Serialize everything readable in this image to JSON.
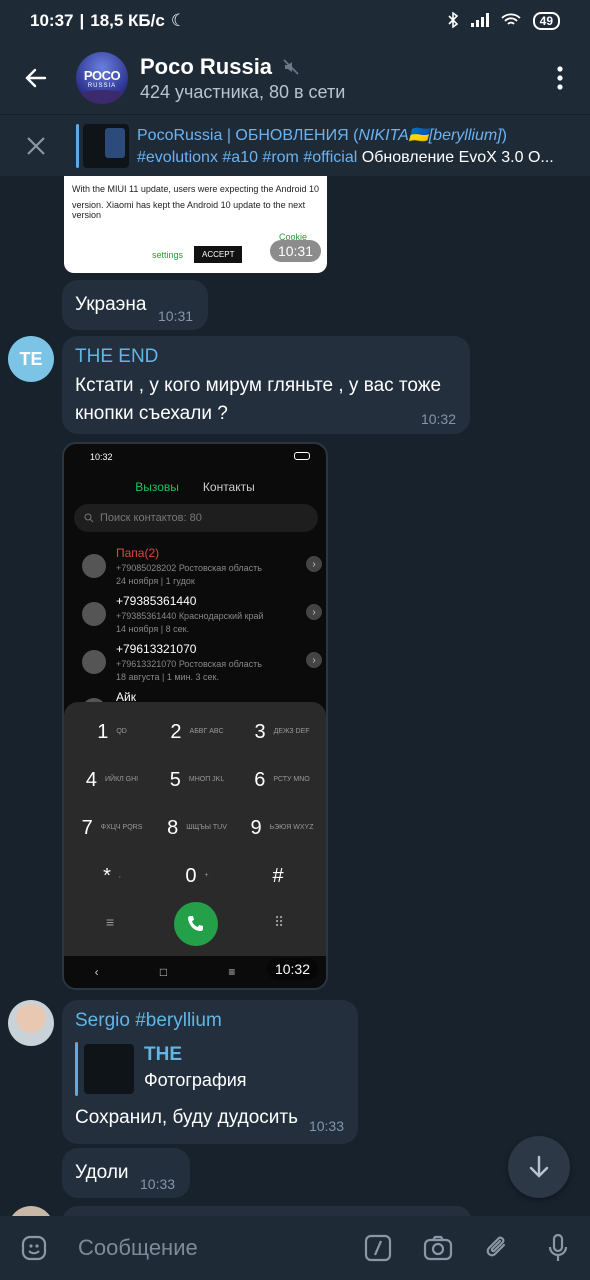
{
  "status_bar": {
    "time": "10:37",
    "speed": "18,5 КБ/с",
    "battery": "49"
  },
  "header": {
    "title": "Poco Russia",
    "subtitle": "424 участника, 80 в сети",
    "avatar_text": "POCO",
    "avatar_sub": "RUSSIA"
  },
  "pinned": {
    "title_prefix": "PocoRussia | ОБНОВЛЕНИЯ (",
    "title_name": "NIKITA🇺🇦[beryllium]",
    "title_suffix": ")",
    "tags": "#evolutionx #a10 #rom #official",
    "text": "Обновление EvoX 3.0 O..."
  },
  "messages": {
    "img1": {
      "line1": "With the MIUI 11 update, users were expecting the Android 10",
      "line2": "version. Xiaomi has kept the Android 10 update to the next version",
      "settings": "settings",
      "accept": "ACCEPT",
      "cookie": "Cookie",
      "time": "10:31"
    },
    "m1": {
      "text": "Украэна",
      "time": "10:31"
    },
    "m2": {
      "avatar": "TE",
      "sender": "THE END",
      "text": "Кстати , у кого мирум гляньте , у вас тоже кнопки съехали ?",
      "time": "10:32"
    },
    "phone": {
      "time": "10:32",
      "status_time": "10:32",
      "tab_calls": "Вызовы",
      "tab_contacts": "Контакты",
      "search": "Поиск контактов: 80",
      "contacts": [
        {
          "name": "Папа(2)",
          "detail1": "+79085028202 Ростовская область",
          "detail2": "24 ноября | 1 гудок"
        },
        {
          "name": "+79385361440",
          "detail1": "+79385361440 Краснодарский край",
          "detail2": "14 ноября | 8 сек."
        },
        {
          "name": "+79613321070",
          "detail1": "+79613321070 Ростовская область",
          "detail2": "18 августа | 1 мин. 3 сек."
        },
        {
          "name": "Айк",
          "detail1": "",
          "detail2": ""
        }
      ],
      "keys": [
        {
          "d": "1",
          "l": "QD"
        },
        {
          "d": "2",
          "l": "АБВГ ABC"
        },
        {
          "d": "3",
          "l": "ДЕЖЗ DEF"
        },
        {
          "d": "4",
          "l": "ИЙКЛ GHI"
        },
        {
          "d": "5",
          "l": "МНОП JKL"
        },
        {
          "d": "6",
          "l": "РСТУ MNO"
        },
        {
          "d": "7",
          "l": "ФХЦЧ PQRS"
        },
        {
          "d": "8",
          "l": "ШЩЪЫ TUV"
        },
        {
          "d": "9",
          "l": "ЬЭЮЯ WXYZ"
        },
        {
          "d": "*",
          "l": ","
        },
        {
          "d": "0",
          "l": "+"
        },
        {
          "d": "#",
          "l": ""
        }
      ]
    },
    "m3": {
      "sender": "Sergio #beryllium",
      "reply_name": "THE",
      "reply_text": "Фотография",
      "text": "Сохранил, буду дудосить",
      "time": "10:33"
    },
    "m4": {
      "text": "Удоли",
      "time": "10:33"
    }
  },
  "input": {
    "placeholder": "Сообщение"
  }
}
